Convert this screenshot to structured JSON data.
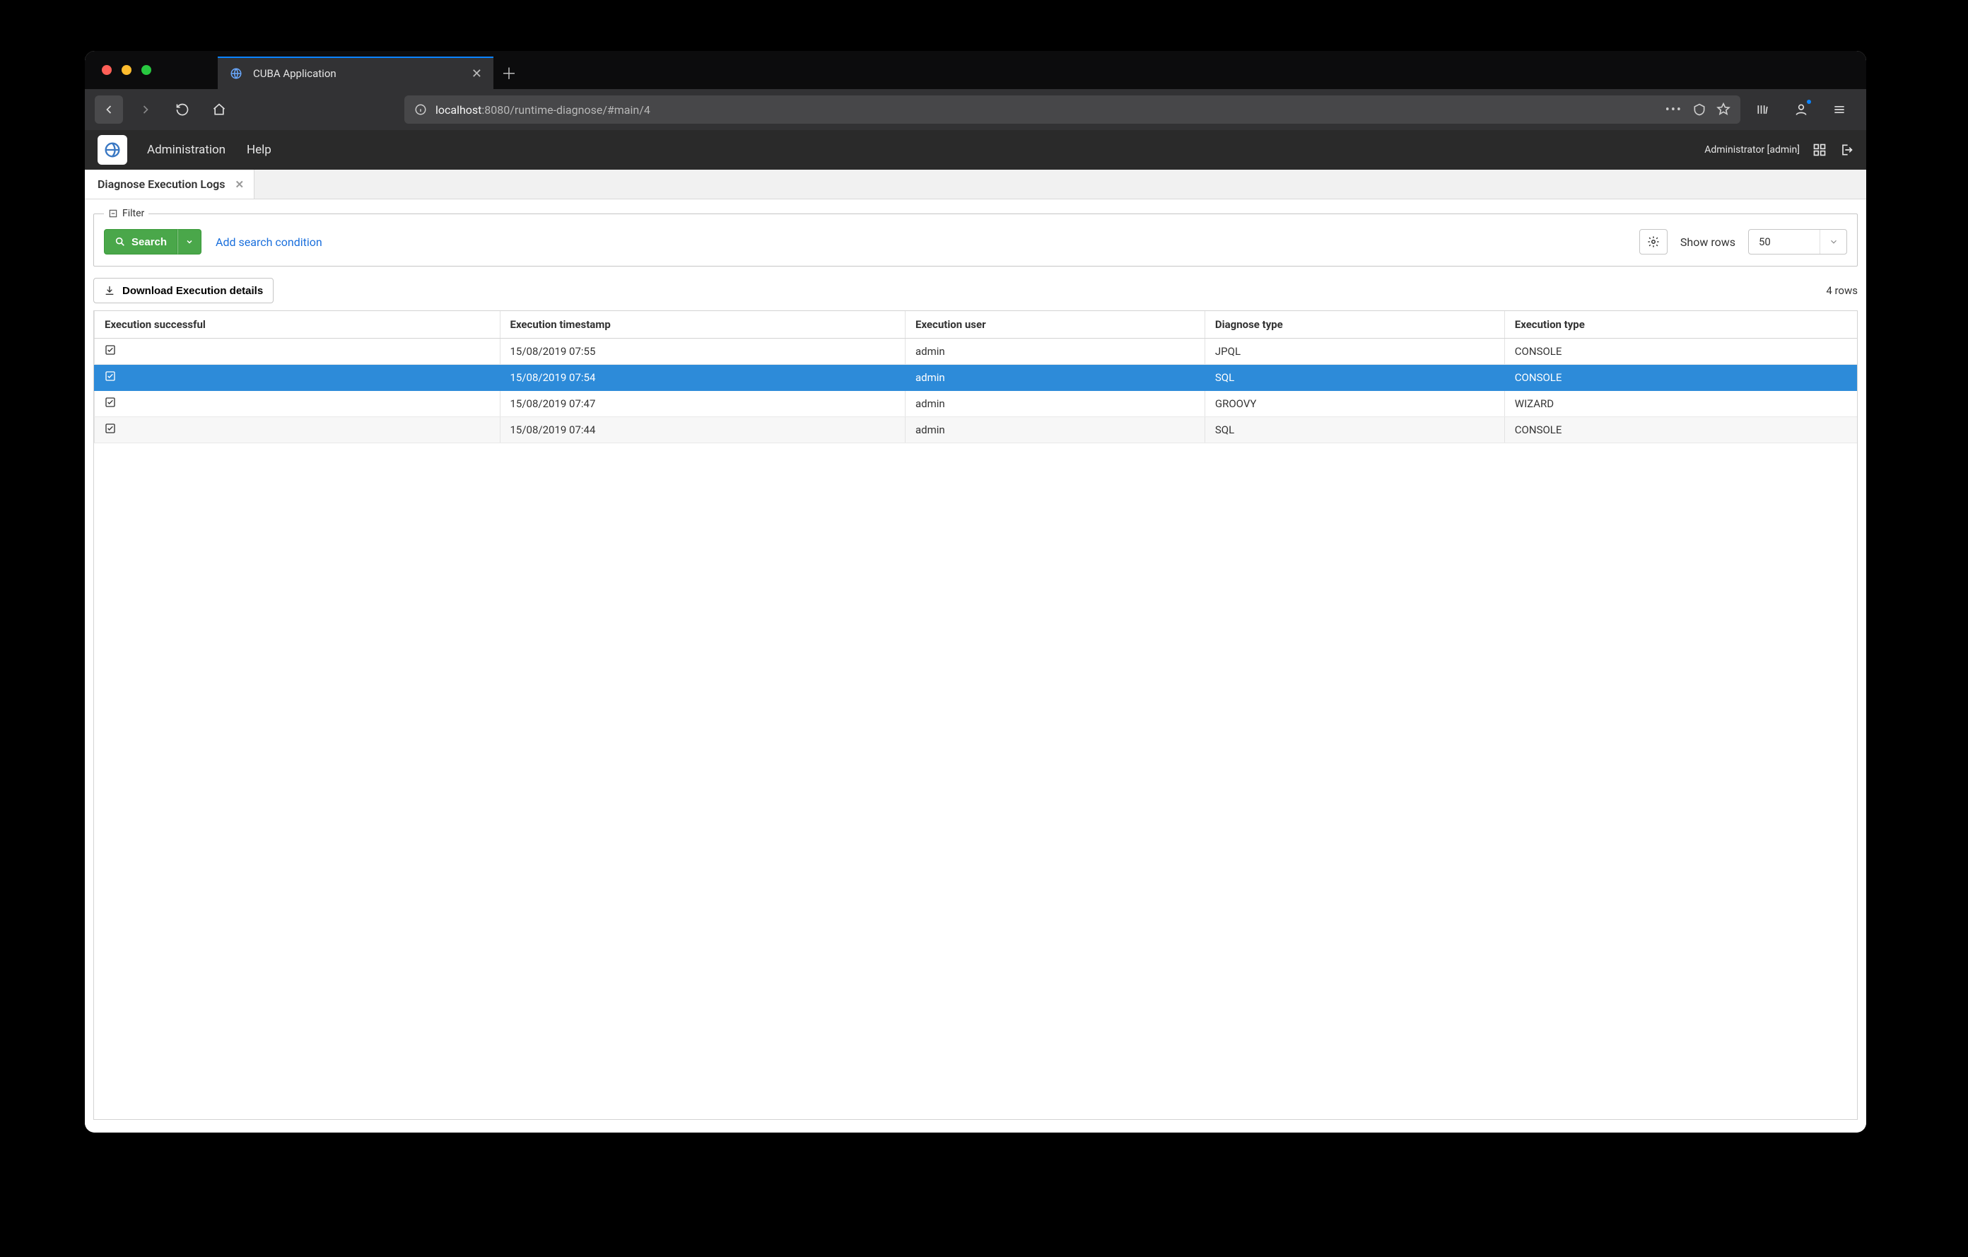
{
  "browser": {
    "tab_title": "CUBA Application",
    "url_host": "localhost",
    "url_port_path": ":8080/runtime-diagnose/#main/4"
  },
  "appbar": {
    "menu": {
      "admin": "Administration",
      "help": "Help"
    },
    "user_label": "Administrator [admin]"
  },
  "page_tabs": {
    "active": "Diagnose Execution Logs"
  },
  "filter": {
    "legend": "Filter",
    "search_label": "Search",
    "add_condition": "Add search condition",
    "show_rows_label": "Show rows",
    "show_rows_value": "50"
  },
  "toolbar": {
    "download_label": "Download Execution details",
    "rows_count": "4 rows"
  },
  "table": {
    "columns": {
      "success": "Execution successful",
      "timestamp": "Execution timestamp",
      "user": "Execution user",
      "diagnose": "Diagnose type",
      "exec": "Execution type"
    },
    "rows": [
      {
        "successful": true,
        "timestamp": "15/08/2019 07:55",
        "user": "admin",
        "diagnose": "JPQL",
        "exec": "CONSOLE",
        "selected": false
      },
      {
        "successful": true,
        "timestamp": "15/08/2019 07:54",
        "user": "admin",
        "diagnose": "SQL",
        "exec": "CONSOLE",
        "selected": true
      },
      {
        "successful": true,
        "timestamp": "15/08/2019 07:47",
        "user": "admin",
        "diagnose": "GROOVY",
        "exec": "WIZARD",
        "selected": false
      },
      {
        "successful": true,
        "timestamp": "15/08/2019 07:44",
        "user": "admin",
        "diagnose": "SQL",
        "exec": "CONSOLE",
        "selected": false
      }
    ]
  }
}
